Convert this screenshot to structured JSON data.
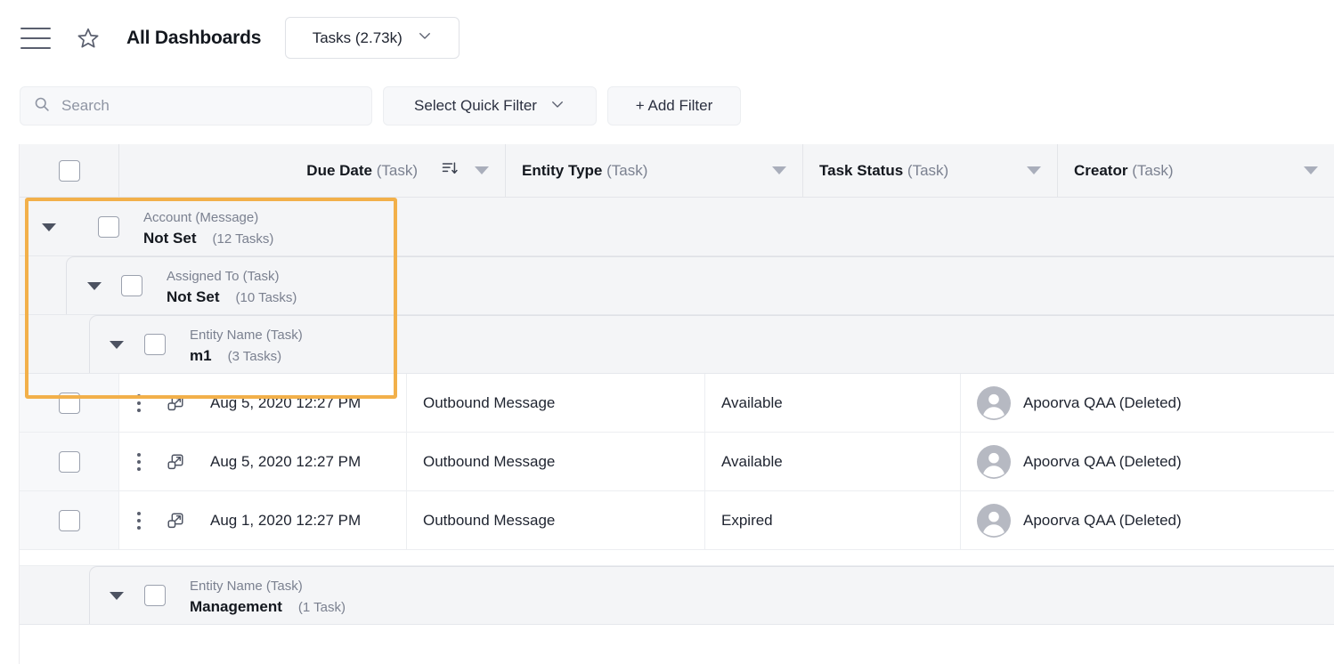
{
  "topbar": {
    "menu_icon": "hamburger-icon",
    "favorite_icon": "star-icon",
    "title": "All Dashboards",
    "entity_select": {
      "label": "Tasks (2.73k)",
      "chevron_icon": "chevron-down-icon"
    }
  },
  "filterbar": {
    "search": {
      "placeholder": "Search",
      "value": "",
      "icon": "search-icon"
    },
    "quick_filter": {
      "label": "Select Quick Filter",
      "chevron_icon": "chevron-down-icon"
    },
    "add_filter": {
      "label": "+ Add Filter"
    }
  },
  "grid": {
    "columns": [
      {
        "name": "Due Date",
        "source": "(Task)",
        "sort_icon": "sort-descending-icon",
        "menu_icon": "caret-down-icon"
      },
      {
        "name": "Entity Type",
        "source": "(Task)",
        "menu_icon": "caret-down-icon"
      },
      {
        "name": "Task Status",
        "source": "(Task)",
        "menu_icon": "caret-down-icon"
      },
      {
        "name": "Creator",
        "source": "(Task)",
        "menu_icon": "caret-down-icon"
      }
    ],
    "groups": [
      {
        "field": "Account (Message)",
        "value": "Not Set",
        "count": "(12 Tasks)",
        "level": 1,
        "expanded": true
      },
      {
        "field": "Assigned To (Task)",
        "value": "Not Set",
        "count": "(10 Tasks)",
        "level": 2,
        "expanded": true
      },
      {
        "field": "Entity Name (Task)",
        "value": "m1",
        "count": "(3 Tasks)",
        "level": 3,
        "expanded": true
      }
    ],
    "rows": [
      {
        "due_date": "Aug 5, 2020 12:27 PM",
        "entity_type": "Outbound Message",
        "task_status": "Available",
        "creator": "Apoorva QAA (Deleted)"
      },
      {
        "due_date": "Aug 5, 2020 12:27 PM",
        "entity_type": "Outbound Message",
        "task_status": "Available",
        "creator": "Apoorva QAA (Deleted)"
      },
      {
        "due_date": "Aug 1, 2020 12:27 PM",
        "entity_type": "Outbound Message",
        "task_status": "Expired",
        "creator": "Apoorva QAA (Deleted)"
      }
    ],
    "next_group": {
      "field": "Entity Name (Task)",
      "value": "Management",
      "count": "(1 Task)",
      "level": 3,
      "expanded": true
    },
    "row_icons": {
      "menu": "kebab-menu-icon",
      "popout": "open-in-new-window-icon",
      "avatar": "user-avatar-icon"
    }
  },
  "colors": {
    "highlight": "#f2b04a",
    "header_bg": "#f4f5f7",
    "group_bg": "#f4f5f7",
    "text": "#1f2430",
    "muted": "#7b8190"
  }
}
